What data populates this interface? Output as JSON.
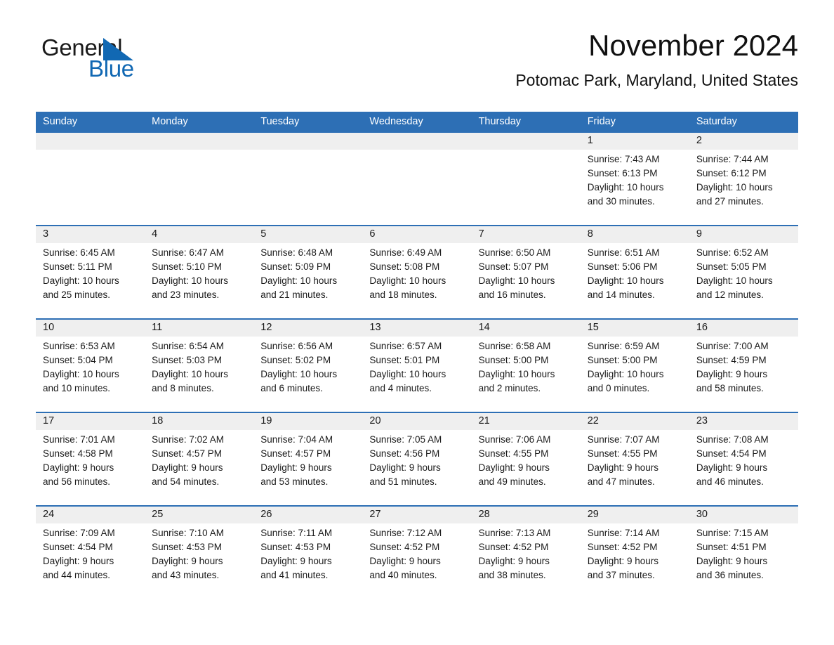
{
  "brand": {
    "name_part1": "General",
    "name_part2": "Blue",
    "triangle_icon": "brand-triangle-icon",
    "color_black": "#1a1a1a",
    "color_blue": "#1168b3"
  },
  "header": {
    "title": "November 2024",
    "subtitle": "Potomac Park, Maryland, United States"
  },
  "theme": {
    "header_bar": "#2d6fb5",
    "daynum_band": "#efefef",
    "row_separator": "#2d6fb5",
    "text": "#1a1a1a",
    "page_background": "#ffffff"
  },
  "calendar": {
    "weekdays": [
      "Sunday",
      "Monday",
      "Tuesday",
      "Wednesday",
      "Thursday",
      "Friday",
      "Saturday"
    ],
    "weeks": [
      [
        {
          "day": "",
          "sunrise": "",
          "sunset": "",
          "daylight_line1": "",
          "daylight_line2": ""
        },
        {
          "day": "",
          "sunrise": "",
          "sunset": "",
          "daylight_line1": "",
          "daylight_line2": ""
        },
        {
          "day": "",
          "sunrise": "",
          "sunset": "",
          "daylight_line1": "",
          "daylight_line2": ""
        },
        {
          "day": "",
          "sunrise": "",
          "sunset": "",
          "daylight_line1": "",
          "daylight_line2": ""
        },
        {
          "day": "",
          "sunrise": "",
          "sunset": "",
          "daylight_line1": "",
          "daylight_line2": ""
        },
        {
          "day": "1",
          "sunrise": "Sunrise: 7:43 AM",
          "sunset": "Sunset: 6:13 PM",
          "daylight_line1": "Daylight: 10 hours",
          "daylight_line2": "and 30 minutes."
        },
        {
          "day": "2",
          "sunrise": "Sunrise: 7:44 AM",
          "sunset": "Sunset: 6:12 PM",
          "daylight_line1": "Daylight: 10 hours",
          "daylight_line2": "and 27 minutes."
        }
      ],
      [
        {
          "day": "3",
          "sunrise": "Sunrise: 6:45 AM",
          "sunset": "Sunset: 5:11 PM",
          "daylight_line1": "Daylight: 10 hours",
          "daylight_line2": "and 25 minutes."
        },
        {
          "day": "4",
          "sunrise": "Sunrise: 6:47 AM",
          "sunset": "Sunset: 5:10 PM",
          "daylight_line1": "Daylight: 10 hours",
          "daylight_line2": "and 23 minutes."
        },
        {
          "day": "5",
          "sunrise": "Sunrise: 6:48 AM",
          "sunset": "Sunset: 5:09 PM",
          "daylight_line1": "Daylight: 10 hours",
          "daylight_line2": "and 21 minutes."
        },
        {
          "day": "6",
          "sunrise": "Sunrise: 6:49 AM",
          "sunset": "Sunset: 5:08 PM",
          "daylight_line1": "Daylight: 10 hours",
          "daylight_line2": "and 18 minutes."
        },
        {
          "day": "7",
          "sunrise": "Sunrise: 6:50 AM",
          "sunset": "Sunset: 5:07 PM",
          "daylight_line1": "Daylight: 10 hours",
          "daylight_line2": "and 16 minutes."
        },
        {
          "day": "8",
          "sunrise": "Sunrise: 6:51 AM",
          "sunset": "Sunset: 5:06 PM",
          "daylight_line1": "Daylight: 10 hours",
          "daylight_line2": "and 14 minutes."
        },
        {
          "day": "9",
          "sunrise": "Sunrise: 6:52 AM",
          "sunset": "Sunset: 5:05 PM",
          "daylight_line1": "Daylight: 10 hours",
          "daylight_line2": "and 12 minutes."
        }
      ],
      [
        {
          "day": "10",
          "sunrise": "Sunrise: 6:53 AM",
          "sunset": "Sunset: 5:04 PM",
          "daylight_line1": "Daylight: 10 hours",
          "daylight_line2": "and 10 minutes."
        },
        {
          "day": "11",
          "sunrise": "Sunrise: 6:54 AM",
          "sunset": "Sunset: 5:03 PM",
          "daylight_line1": "Daylight: 10 hours",
          "daylight_line2": "and 8 minutes."
        },
        {
          "day": "12",
          "sunrise": "Sunrise: 6:56 AM",
          "sunset": "Sunset: 5:02 PM",
          "daylight_line1": "Daylight: 10 hours",
          "daylight_line2": "and 6 minutes."
        },
        {
          "day": "13",
          "sunrise": "Sunrise: 6:57 AM",
          "sunset": "Sunset: 5:01 PM",
          "daylight_line1": "Daylight: 10 hours",
          "daylight_line2": "and 4 minutes."
        },
        {
          "day": "14",
          "sunrise": "Sunrise: 6:58 AM",
          "sunset": "Sunset: 5:00 PM",
          "daylight_line1": "Daylight: 10 hours",
          "daylight_line2": "and 2 minutes."
        },
        {
          "day": "15",
          "sunrise": "Sunrise: 6:59 AM",
          "sunset": "Sunset: 5:00 PM",
          "daylight_line1": "Daylight: 10 hours",
          "daylight_line2": "and 0 minutes."
        },
        {
          "day": "16",
          "sunrise": "Sunrise: 7:00 AM",
          "sunset": "Sunset: 4:59 PM",
          "daylight_line1": "Daylight: 9 hours",
          "daylight_line2": "and 58 minutes."
        }
      ],
      [
        {
          "day": "17",
          "sunrise": "Sunrise: 7:01 AM",
          "sunset": "Sunset: 4:58 PM",
          "daylight_line1": "Daylight: 9 hours",
          "daylight_line2": "and 56 minutes."
        },
        {
          "day": "18",
          "sunrise": "Sunrise: 7:02 AM",
          "sunset": "Sunset: 4:57 PM",
          "daylight_line1": "Daylight: 9 hours",
          "daylight_line2": "and 54 minutes."
        },
        {
          "day": "19",
          "sunrise": "Sunrise: 7:04 AM",
          "sunset": "Sunset: 4:57 PM",
          "daylight_line1": "Daylight: 9 hours",
          "daylight_line2": "and 53 minutes."
        },
        {
          "day": "20",
          "sunrise": "Sunrise: 7:05 AM",
          "sunset": "Sunset: 4:56 PM",
          "daylight_line1": "Daylight: 9 hours",
          "daylight_line2": "and 51 minutes."
        },
        {
          "day": "21",
          "sunrise": "Sunrise: 7:06 AM",
          "sunset": "Sunset: 4:55 PM",
          "daylight_line1": "Daylight: 9 hours",
          "daylight_line2": "and 49 minutes."
        },
        {
          "day": "22",
          "sunrise": "Sunrise: 7:07 AM",
          "sunset": "Sunset: 4:55 PM",
          "daylight_line1": "Daylight: 9 hours",
          "daylight_line2": "and 47 minutes."
        },
        {
          "day": "23",
          "sunrise": "Sunrise: 7:08 AM",
          "sunset": "Sunset: 4:54 PM",
          "daylight_line1": "Daylight: 9 hours",
          "daylight_line2": "and 46 minutes."
        }
      ],
      [
        {
          "day": "24",
          "sunrise": "Sunrise: 7:09 AM",
          "sunset": "Sunset: 4:54 PM",
          "daylight_line1": "Daylight: 9 hours",
          "daylight_line2": "and 44 minutes."
        },
        {
          "day": "25",
          "sunrise": "Sunrise: 7:10 AM",
          "sunset": "Sunset: 4:53 PM",
          "daylight_line1": "Daylight: 9 hours",
          "daylight_line2": "and 43 minutes."
        },
        {
          "day": "26",
          "sunrise": "Sunrise: 7:11 AM",
          "sunset": "Sunset: 4:53 PM",
          "daylight_line1": "Daylight: 9 hours",
          "daylight_line2": "and 41 minutes."
        },
        {
          "day": "27",
          "sunrise": "Sunrise: 7:12 AM",
          "sunset": "Sunset: 4:52 PM",
          "daylight_line1": "Daylight: 9 hours",
          "daylight_line2": "and 40 minutes."
        },
        {
          "day": "28",
          "sunrise": "Sunrise: 7:13 AM",
          "sunset": "Sunset: 4:52 PM",
          "daylight_line1": "Daylight: 9 hours",
          "daylight_line2": "and 38 minutes."
        },
        {
          "day": "29",
          "sunrise": "Sunrise: 7:14 AM",
          "sunset": "Sunset: 4:52 PM",
          "daylight_line1": "Daylight: 9 hours",
          "daylight_line2": "and 37 minutes."
        },
        {
          "day": "30",
          "sunrise": "Sunrise: 7:15 AM",
          "sunset": "Sunset: 4:51 PM",
          "daylight_line1": "Daylight: 9 hours",
          "daylight_line2": "and 36 minutes."
        }
      ]
    ]
  }
}
